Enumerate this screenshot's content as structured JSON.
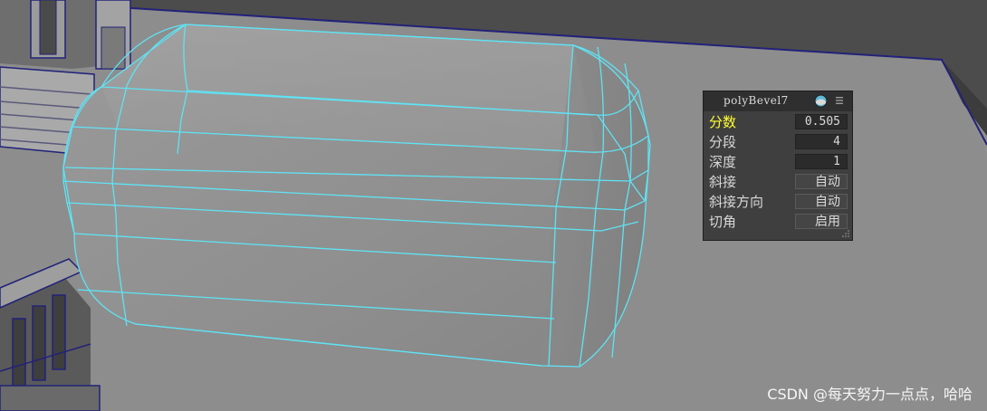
{
  "panel": {
    "title": "polyBevel7",
    "rows": [
      {
        "label": "分数",
        "value": "0.505",
        "active": true
      },
      {
        "label": "分段",
        "value": "4"
      },
      {
        "label": "深度",
        "value": "1"
      },
      {
        "label": "斜接",
        "value": "自动"
      },
      {
        "label": "斜接方向",
        "value": "自动"
      },
      {
        "label": "切角",
        "value": "启用"
      }
    ]
  },
  "watermark": "CSDN @每天努力一点点，哈哈",
  "colors": {
    "wireframe": "#5fe3f4",
    "active_label": "#ffff33",
    "scene_edge": "#22227a"
  },
  "icons": {
    "globe": "globe-icon",
    "menu": "menu-icon",
    "grip": "resize-grip-icon"
  }
}
